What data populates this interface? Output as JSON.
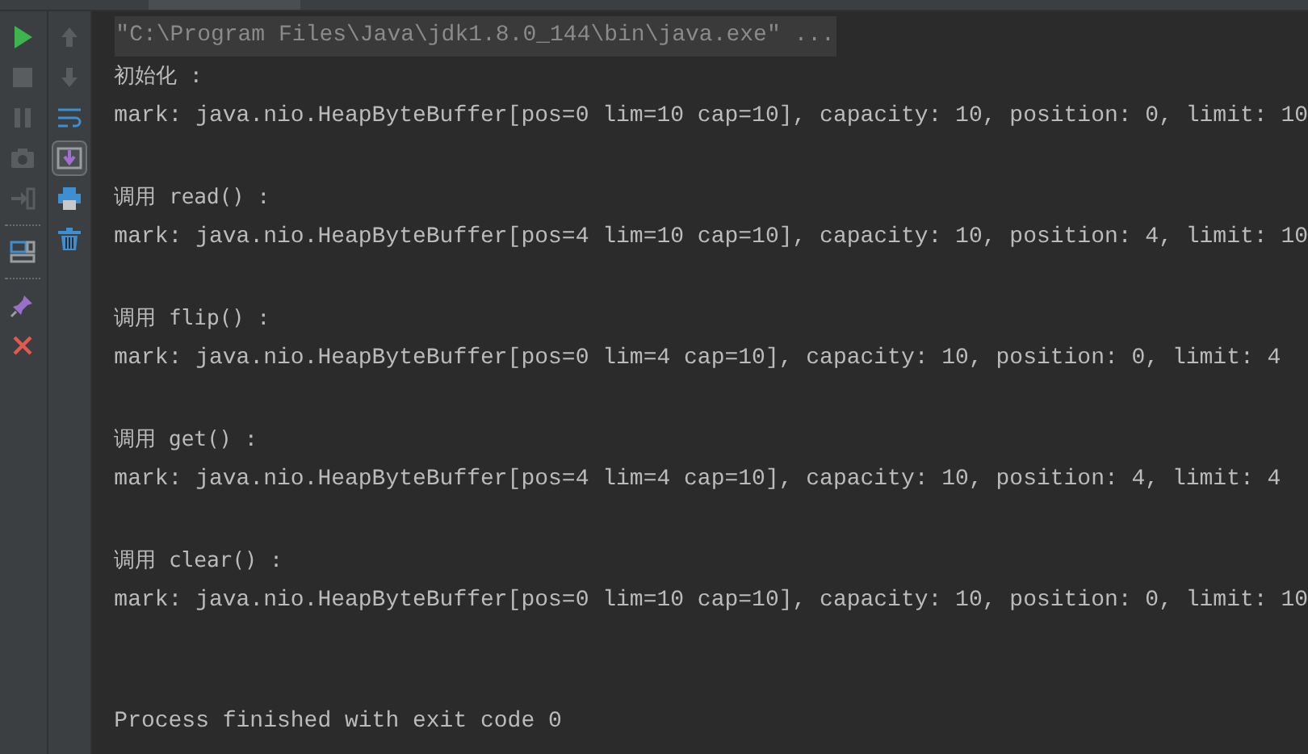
{
  "console": {
    "command": "\"C:\\Program Files\\Java\\jdk1.8.0_144\\bin\\java.exe\" ...",
    "sections": [
      {
        "heading": "初始化 :",
        "output": "mark: java.nio.HeapByteBuffer[pos=0 lim=10 cap=10], capacity: 10, position: 0, limit: 10"
      },
      {
        "heading": "调用 read() :",
        "output": "mark: java.nio.HeapByteBuffer[pos=4 lim=10 cap=10], capacity: 10, position: 4, limit: 10"
      },
      {
        "heading": "调用 flip() :",
        "output": "mark: java.nio.HeapByteBuffer[pos=0 lim=4 cap=10], capacity: 10, position: 0, limit: 4"
      },
      {
        "heading": "调用 get() :",
        "output": "mark: java.nio.HeapByteBuffer[pos=4 lim=4 cap=10], capacity: 10, position: 4, limit: 4"
      },
      {
        "heading": "调用 clear() :",
        "output": "mark: java.nio.HeapByteBuffer[pos=0 lim=10 cap=10], capacity: 10, position: 0, limit: 10"
      }
    ],
    "exit_message": "Process finished with exit code 0"
  }
}
